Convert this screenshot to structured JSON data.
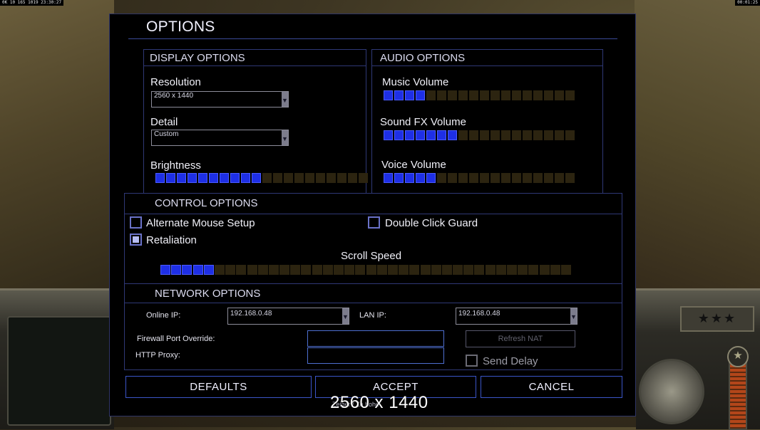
{
  "top_status": {
    "left_text": "0K 10 165 1019 23:30:27",
    "right_text": "00:01:25"
  },
  "hud": {
    "rank_stars": "★★★",
    "medal_icon": "★"
  },
  "dialog": {
    "title": "OPTIONS"
  },
  "display_options": {
    "header": "DISPLAY OPTIONS",
    "resolution": {
      "label": "Resolution",
      "value": "2560 x 1440"
    },
    "detail": {
      "label": "Detail",
      "value": "Custom"
    },
    "brightness": {
      "label": "Brightness",
      "level": 10,
      "segments": 20
    }
  },
  "audio_options": {
    "header": "AUDIO OPTIONS",
    "music": {
      "label": "Music Volume",
      "level": 4,
      "segments": 18
    },
    "sound_fx": {
      "label": "Sound FX Volume",
      "level": 7,
      "segments": 18
    },
    "voice": {
      "label": "Voice Volume",
      "level": 5,
      "segments": 18
    }
  },
  "control_options": {
    "header": "CONTROL OPTIONS",
    "alternate_mouse": {
      "label": "Alternate Mouse Setup",
      "checked": false
    },
    "double_click_guard": {
      "label": "Double Click Guard",
      "checked": false
    },
    "retaliation": {
      "label": "Retaliation",
      "checked": true
    },
    "scroll_speed": {
      "label": "Scroll Speed",
      "level": 5,
      "segments": 38
    }
  },
  "network_options": {
    "header": "NETWORK OPTIONS",
    "online_ip": {
      "label": "Online IP:",
      "value": "192.168.0.48"
    },
    "lan_ip": {
      "label": "LAN IP:",
      "value": "192.168.0.48"
    },
    "firewall_port": {
      "label": "Firewall Port Override:",
      "value": ""
    },
    "http_proxy": {
      "label": "HTTP Proxy:",
      "value": ""
    },
    "refresh_nat": "Refresh NAT",
    "send_delay": {
      "label": "Send Delay",
      "checked": false
    }
  },
  "buttons": {
    "defaults": "DEFAULTS",
    "accept": "ACCEPT",
    "cancel": "CANCEL"
  },
  "overlay": {
    "resolution_text": "2560 x 1440",
    "subtext": "Zeiger / Zo hohe"
  },
  "colors": {
    "slider_on": "#1e2fe6",
    "slider_off": "#2c2410",
    "border_accent": "#3b55c8"
  }
}
